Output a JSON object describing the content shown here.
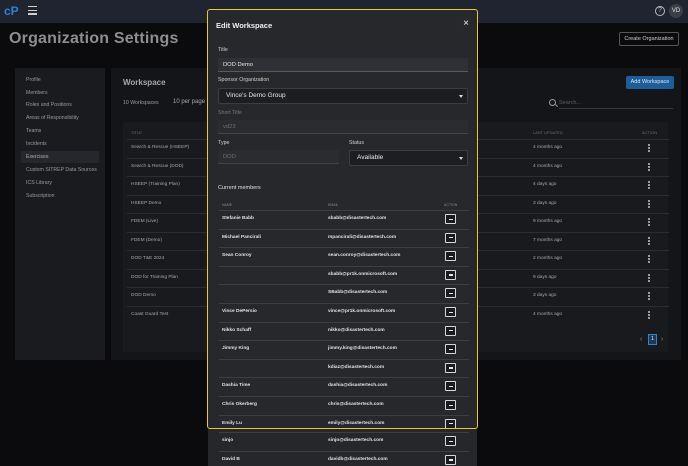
{
  "topbar": {
    "logo": "cP",
    "avatar": "VD"
  },
  "page": {
    "title": "Organization Settings",
    "create_org": "Create Organization"
  },
  "sidebar": {
    "items": [
      {
        "label": "Profile"
      },
      {
        "label": "Members"
      },
      {
        "label": "Roles and Positions"
      },
      {
        "label": "Areas of Responsibility"
      },
      {
        "label": "Teams"
      },
      {
        "label": "Incidents"
      },
      {
        "label": "Exercises"
      },
      {
        "label": "Custom SITREP Data Sources"
      },
      {
        "label": "ICS Library"
      },
      {
        "label": "Subscription"
      }
    ],
    "active_index": 6
  },
  "workspace": {
    "title": "Workspace",
    "add_button": "Add Workspace",
    "count": "10 Workspaces",
    "per_page": "10 per page",
    "search_placeholder": "Search...",
    "headers": {
      "title": "TITLE",
      "updated": "LAST UPDATED",
      "action": "ACTION"
    },
    "rows": [
      {
        "title": "Search & Rescue (HSEEP)",
        "updated": "4 months ago"
      },
      {
        "title": "Search & Rescue (DOD)",
        "updated": "4 months ago"
      },
      {
        "title": "HSEEP (Training Plan)",
        "updated": "4 days ago"
      },
      {
        "title": "HSEEP Demo",
        "updated": "3 days ago"
      },
      {
        "title": "FDEM (Live)",
        "updated": "9 months ago"
      },
      {
        "title": "FDEM (Demo)",
        "updated": "7 months ago"
      },
      {
        "title": "DOD T&E 2024",
        "updated": "2 months ago"
      },
      {
        "title": "DOD for Training Plan",
        "updated": "9 days ago"
      },
      {
        "title": "DOD Demo",
        "updated": "3 days ago"
      },
      {
        "title": "Coast Guard Test",
        "updated": "4 months ago"
      }
    ],
    "page": "1"
  },
  "modal": {
    "title": "Edit Workspace",
    "close": "×",
    "title_label": "Title",
    "title_value": "DOD Demo",
    "sponsor_label": "Sponsor Organization",
    "sponsor_value": "Vince's Demo Group",
    "short_title_label": "Short Title",
    "short_title_value": "vd23",
    "type_label": "Type",
    "type_value": "DOD",
    "status_label": "Status",
    "status_value": "Available",
    "members_title": "Current members",
    "members_headers": {
      "name": "NAME",
      "email": "EMAIL",
      "action": "ACTION"
    },
    "members": [
      {
        "name": "Stefanie Babb",
        "email": "sbabb@disastertech.com"
      },
      {
        "name": "Michael Pancirali",
        "email": "mpancirali@disastertech.com"
      },
      {
        "name": "Sean Conroy",
        "email": "sean.conroy@disastertech.com"
      },
      {
        "name": "",
        "email": "sbabb@pr1k.onmicrosoft.com"
      },
      {
        "name": "",
        "email": "SBabb@disastertech.com"
      },
      {
        "name": "Vince DePersio",
        "email": "vince@pr1k.onmicrosoft.com"
      },
      {
        "name": "Nikko Schaff",
        "email": "nikko@disastertech.com"
      },
      {
        "name": "Jimmy King",
        "email": "jimmy.king@disastertech.com"
      },
      {
        "name": "",
        "email": "kdiaz@disastertech.com"
      },
      {
        "name": "Dashia Time",
        "email": "dashia@disastertech.com"
      },
      {
        "name": "Chris Okerberg",
        "email": "chris@disastertech.com"
      },
      {
        "name": "Emily Lu",
        "email": "emily@disastertech.com"
      },
      {
        "name": "sinjo",
        "email": "sinjo@disastertech.com"
      },
      {
        "name": "David B",
        "email": "davidb@disastertech.com"
      }
    ]
  }
}
